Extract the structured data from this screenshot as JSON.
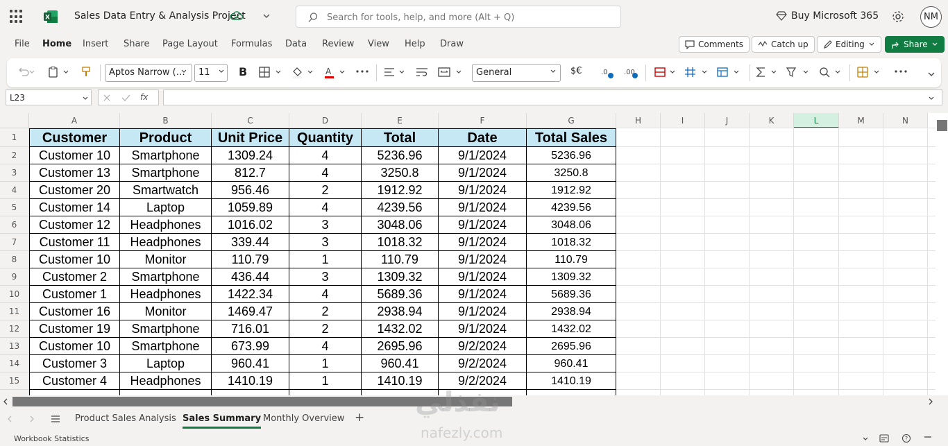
{
  "titlebar": {
    "doc_title": "Sales Data Entry & Analysis Project",
    "search_placeholder": "Search for tools, help, and more (Alt + Q)",
    "buy_label": "Buy Microsoft 365",
    "avatar_initials": "NM",
    "brand_color": "#107c41"
  },
  "menu": {
    "items": [
      "File",
      "Home",
      "Insert",
      "Share",
      "Page Layout",
      "Formulas",
      "Data",
      "Review",
      "View",
      "Help",
      "Draw"
    ],
    "active": "Home",
    "comments_label": "Comments",
    "catchup_label": "Catch up",
    "editing_label": "Editing",
    "share_label": "Share"
  },
  "ribbon": {
    "font_name": "Aptos Narrow (…",
    "font_size": "11",
    "number_format": "General",
    "bold_label": "B",
    "currency_label": "$€"
  },
  "formula_bar": {
    "name_box": "L23",
    "fx_label": "fx",
    "formula": ""
  },
  "sheet": {
    "columns": [
      "A",
      "B",
      "C",
      "D",
      "E",
      "F",
      "G",
      "H",
      "I",
      "J",
      "K",
      "L",
      "M",
      "N"
    ],
    "selected_column": "L",
    "row_numbers": [
      "1",
      "2",
      "3",
      "4",
      "5",
      "6",
      "7",
      "8",
      "9",
      "10",
      "11",
      "12",
      "13",
      "14",
      "15"
    ],
    "header": [
      "Customer",
      "Product",
      "Unit Price",
      "Quantity",
      "Total",
      "Date",
      "Total  Sales"
    ],
    "rows": [
      [
        "Customer 10",
        "Smartphone",
        "1309.24",
        "4",
        "5236.96",
        "9/1/2024",
        "5236.96"
      ],
      [
        "Customer 13",
        "Smartphone",
        "812.7",
        "4",
        "3250.8",
        "9/1/2024",
        "3250.8"
      ],
      [
        "Customer 20",
        "Smartwatch",
        "956.46",
        "2",
        "1912.92",
        "9/1/2024",
        "1912.92"
      ],
      [
        "Customer 14",
        "Laptop",
        "1059.89",
        "4",
        "4239.56",
        "9/1/2024",
        "4239.56"
      ],
      [
        "Customer 12",
        "Headphones",
        "1016.02",
        "3",
        "3048.06",
        "9/1/2024",
        "3048.06"
      ],
      [
        "Customer 11",
        "Headphones",
        "339.44",
        "3",
        "1018.32",
        "9/1/2024",
        "1018.32"
      ],
      [
        "Customer 10",
        "Monitor",
        "110.79",
        "1",
        "110.79",
        "9/1/2024",
        "110.79"
      ],
      [
        "Customer 2",
        "Smartphone",
        "436.44",
        "3",
        "1309.32",
        "9/1/2024",
        "1309.32"
      ],
      [
        "Customer 1",
        "Headphones",
        "1422.34",
        "4",
        "5689.36",
        "9/1/2024",
        "5689.36"
      ],
      [
        "Customer 16",
        "Monitor",
        "1469.47",
        "2",
        "2938.94",
        "9/1/2024",
        "2938.94"
      ],
      [
        "Customer 19",
        "Smartphone",
        "716.01",
        "2",
        "1432.02",
        "9/1/2024",
        "1432.02"
      ],
      [
        "Customer 10",
        "Smartphone",
        "673.99",
        "4",
        "2695.96",
        "9/2/2024",
        "2695.96"
      ],
      [
        "Customer 3",
        "Laptop",
        "960.41",
        "1",
        "960.41",
        "9/2/2024",
        "960.41"
      ],
      [
        "Customer 4",
        "Headphones",
        "1410.19",
        "1",
        "1410.19",
        "9/2/2024",
        "1410.19"
      ]
    ],
    "header_fill": "#c6e8f5"
  },
  "tabs": {
    "items": [
      "Product Sales Analysis",
      "Sales Summary",
      "Monthly Overview"
    ],
    "active": "Sales Summary",
    "add_label": "+"
  },
  "status": {
    "text": "Workbook Statistics"
  },
  "watermark": {
    "arabic": "نفذلي",
    "latin": "nafezly.com"
  }
}
